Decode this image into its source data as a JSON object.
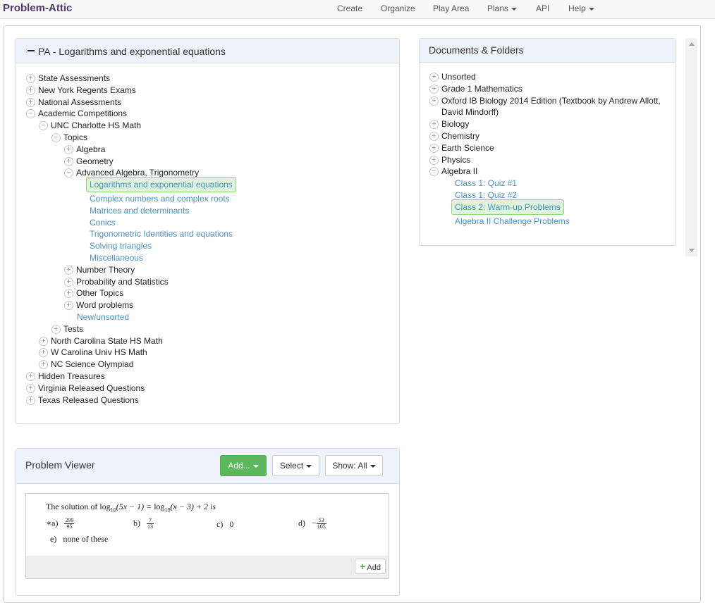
{
  "nav": {
    "brand": "Problem-Attic",
    "items": [
      "Create",
      "Organize",
      "Play Area",
      "Plans",
      "API",
      "Help"
    ]
  },
  "left_panel": {
    "title": "PA - Logarithms and exponential equations",
    "tree": [
      {
        "label": "State Assessments",
        "depth": 0,
        "state": "plus"
      },
      {
        "label": "New York Regents Exams",
        "depth": 0,
        "state": "plus"
      },
      {
        "label": "National Assessments",
        "depth": 0,
        "state": "plus"
      },
      {
        "label": "Academic Competitions",
        "depth": 0,
        "state": "minus"
      },
      {
        "label": "UNC Charlotte HS Math",
        "depth": 1,
        "state": "minus"
      },
      {
        "label": "Topics",
        "depth": 2,
        "state": "minus"
      },
      {
        "label": "Algebra",
        "depth": 3,
        "state": "plus"
      },
      {
        "label": "Geometry",
        "depth": 3,
        "state": "plus"
      },
      {
        "label": "Advanced Algebra, Trigonometry",
        "depth": 3,
        "state": "minus"
      },
      {
        "label": "Logarithms and exponential equations",
        "depth": 4,
        "state": "link-selected"
      },
      {
        "label": "Complex numbers and complex roots",
        "depth": 4,
        "state": "link"
      },
      {
        "label": "Matrices and determinants",
        "depth": 4,
        "state": "link"
      },
      {
        "label": "Conics",
        "depth": 4,
        "state": "link"
      },
      {
        "label": "Trigonometric Identities and equations",
        "depth": 4,
        "state": "link"
      },
      {
        "label": "Solving triangles",
        "depth": 4,
        "state": "link"
      },
      {
        "label": "Miscellaneous",
        "depth": 4,
        "state": "link"
      },
      {
        "label": "Number Theory",
        "depth": 3,
        "state": "plus"
      },
      {
        "label": "Probability and Statistics",
        "depth": 3,
        "state": "plus"
      },
      {
        "label": "Other Topics",
        "depth": 3,
        "state": "plus"
      },
      {
        "label": "Word problems",
        "depth": 3,
        "state": "plus"
      },
      {
        "label": "New/unsorted",
        "depth": 3,
        "state": "link"
      },
      {
        "label": "Tests",
        "depth": 2,
        "state": "plus"
      },
      {
        "label": "North Carolina State HS Math",
        "depth": 1,
        "state": "plus"
      },
      {
        "label": "W Carolina Univ HS Math",
        "depth": 1,
        "state": "plus"
      },
      {
        "label": "NC Science Olympiad",
        "depth": 1,
        "state": "plus"
      },
      {
        "label": "Hidden Treasures",
        "depth": 0,
        "state": "plus"
      },
      {
        "label": "Virginia Released Questions",
        "depth": 0,
        "state": "plus"
      },
      {
        "label": "Texas Released Questions",
        "depth": 0,
        "state": "plus"
      }
    ]
  },
  "right_panel": {
    "title": "Documents & Folders",
    "tree": [
      {
        "label": "Unsorted",
        "depth": 0,
        "state": "plus"
      },
      {
        "label": "Grade 1 Mathematics",
        "depth": 0,
        "state": "plus"
      },
      {
        "label": "Oxford IB Biology 2014 Edition (Textbook by Andrew Allott,",
        "label2": "David Mindorff)",
        "depth": 0,
        "state": "plus"
      },
      {
        "label": "Biology",
        "depth": 0,
        "state": "plus"
      },
      {
        "label": "Chemistry",
        "depth": 0,
        "state": "plus"
      },
      {
        "label": "Earth Science",
        "depth": 0,
        "state": "plus"
      },
      {
        "label": "Physics",
        "depth": 0,
        "state": "plus"
      },
      {
        "label": "Algebra II",
        "depth": 0,
        "state": "minus"
      },
      {
        "label": "Class 1: Quiz #1",
        "depth": 1,
        "state": "link"
      },
      {
        "label": "Class 1: Quiz #2",
        "depth": 1,
        "state": "link"
      },
      {
        "label": "Class 2: Warm-up Problems",
        "depth": 1,
        "state": "link-selected"
      },
      {
        "label": "Algebra II Challenge Problems",
        "depth": 1,
        "state": "link"
      }
    ]
  },
  "viewer": {
    "title": "Problem Viewer",
    "add_label": "Add...",
    "select_label": "Select",
    "show_label": "Show: All",
    "add_small_label": "Add",
    "problem": {
      "stem_prefix": "The solution of ",
      "log": "log",
      "base": "10",
      "expr1": "(5x − 1) = ",
      "expr2": "(x − 3) + 2 is",
      "choice_a_label": "∗a)",
      "choice_a_num": "299",
      "choice_a_den": "95",
      "choice_b_label": "b)",
      "choice_b_num": "7",
      "choice_b_den": "13",
      "choice_c_label": "c)",
      "choice_c_value": "0",
      "choice_d_label": "d)",
      "choice_d_sign": "−",
      "choice_d_num": "53",
      "choice_d_den": "105",
      "choice_e_label": "e)",
      "choice_e_value": "none of these"
    }
  },
  "colors": {
    "brand": "#4e3a6e",
    "link": "#4a90c8",
    "selected_bg": "#dff5d9",
    "selected_border": "#8fd57b",
    "panel_heading": "#eef2fa",
    "green_button": "#5cb85c"
  }
}
